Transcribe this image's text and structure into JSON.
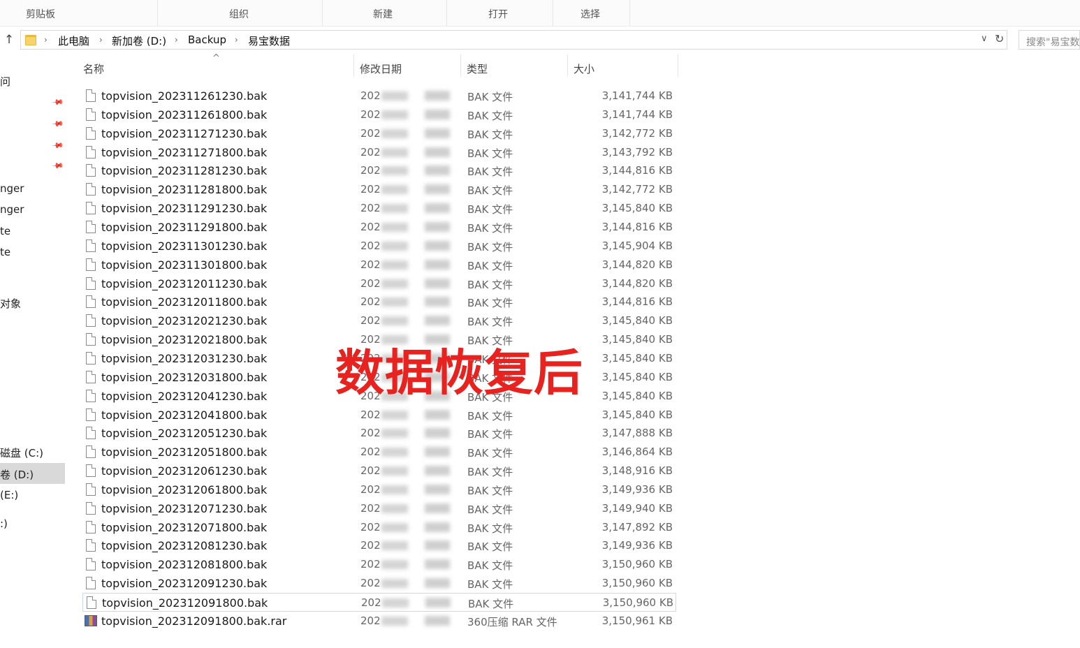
{
  "ribbon": {
    "groups": [
      "剪贴板",
      "组织",
      "新建",
      "打开",
      "选择"
    ]
  },
  "address": {
    "up_glyph": "↑",
    "breadcrumb": [
      "此电脑",
      "新加卷 (D:)",
      "Backup",
      "易宝数据"
    ],
    "separator": "›",
    "dropdown_glyph": "∨",
    "refresh_glyph": "↻",
    "search_placeholder": "搜索\"易宝数"
  },
  "nav": {
    "items": [
      "问",
      "nger",
      "nger",
      "te",
      "te",
      "对象",
      "磁盘 (C:)",
      "卷 (D:)",
      "(E:)",
      ":)"
    ],
    "pin_glyph": "📌"
  },
  "columns": {
    "name": "名称",
    "date": "修改日期",
    "type": "类型",
    "size": "大小",
    "sort_glyph": "^"
  },
  "files": [
    {
      "name": "topvision_202311261230.bak",
      "date": "202",
      "type": "BAK 文件",
      "size": "3,141,744 KB"
    },
    {
      "name": "topvision_202311261800.bak",
      "date": "202",
      "type": "BAK 文件",
      "size": "3,141,744 KB"
    },
    {
      "name": "topvision_202311271230.bak",
      "date": "202",
      "type": "BAK 文件",
      "size": "3,142,772 KB"
    },
    {
      "name": "topvision_202311271800.bak",
      "date": "202",
      "type": "BAK 文件",
      "size": "3,143,792 KB"
    },
    {
      "name": "topvision_202311281230.bak",
      "date": "202",
      "type": "BAK 文件",
      "size": "3,144,816 KB"
    },
    {
      "name": "topvision_202311281800.bak",
      "date": "202",
      "type": "BAK 文件",
      "size": "3,142,772 KB"
    },
    {
      "name": "topvision_202311291230.bak",
      "date": "202",
      "type": "BAK 文件",
      "size": "3,145,840 KB"
    },
    {
      "name": "topvision_202311291800.bak",
      "date": "202",
      "type": "BAK 文件",
      "size": "3,144,816 KB"
    },
    {
      "name": "topvision_202311301230.bak",
      "date": "202",
      "type": "BAK 文件",
      "size": "3,145,904 KB"
    },
    {
      "name": "topvision_202311301800.bak",
      "date": "202",
      "type": "BAK 文件",
      "size": "3,144,820 KB"
    },
    {
      "name": "topvision_202312011230.bak",
      "date": "202",
      "type": "BAK 文件",
      "size": "3,144,820 KB"
    },
    {
      "name": "topvision_202312011800.bak",
      "date": "202",
      "type": "BAK 文件",
      "size": "3,144,816 KB"
    },
    {
      "name": "topvision_202312021230.bak",
      "date": "202",
      "type": "BAK 文件",
      "size": "3,145,840 KB"
    },
    {
      "name": "topvision_202312021800.bak",
      "date": "202",
      "type": "BAK 文件",
      "size": "3,145,840 KB"
    },
    {
      "name": "topvision_202312031230.bak",
      "date": "202",
      "type": "BAK 文件",
      "size": "3,145,840 KB"
    },
    {
      "name": "topvision_202312031800.bak",
      "date": "202",
      "type": "BAK 文件",
      "size": "3,145,840 KB"
    },
    {
      "name": "topvision_202312041230.bak",
      "date": "202",
      "type": "BAK 文件",
      "size": "3,145,840 KB"
    },
    {
      "name": "topvision_202312041800.bak",
      "date": "202",
      "type": "BAK 文件",
      "size": "3,145,840 KB"
    },
    {
      "name": "topvision_202312051230.bak",
      "date": "202",
      "type": "BAK 文件",
      "size": "3,147,888 KB"
    },
    {
      "name": "topvision_202312051800.bak",
      "date": "202",
      "type": "BAK 文件",
      "size": "3,146,864 KB"
    },
    {
      "name": "topvision_202312061230.bak",
      "date": "202",
      "type": "BAK 文件",
      "size": "3,148,916 KB"
    },
    {
      "name": "topvision_202312061800.bak",
      "date": "202",
      "type": "BAK 文件",
      "size": "3,149,936 KB"
    },
    {
      "name": "topvision_202312071230.bak",
      "date": "202",
      "type": "BAK 文件",
      "size": "3,149,940 KB"
    },
    {
      "name": "topvision_202312071800.bak",
      "date": "202",
      "type": "BAK 文件",
      "size": "3,147,892 KB"
    },
    {
      "name": "topvision_202312081230.bak",
      "date": "202",
      "type": "BAK 文件",
      "size": "3,149,936 KB"
    },
    {
      "name": "topvision_202312081800.bak",
      "date": "202",
      "type": "BAK 文件",
      "size": "3,150,960 KB"
    },
    {
      "name": "topvision_202312091230.bak",
      "date": "202",
      "type": "BAK 文件",
      "size": "3,150,960 KB"
    },
    {
      "name": "topvision_202312091800.bak",
      "date": "202",
      "type": "BAK 文件",
      "size": "3,150,960 KB"
    },
    {
      "name": "topvision_202312091800.bak.rar",
      "date": "202",
      "type": "360压缩 RAR 文件",
      "size": "3,150,961 KB"
    }
  ],
  "overlay": {
    "caption": "数据恢复后",
    "color": "#e8231f"
  }
}
